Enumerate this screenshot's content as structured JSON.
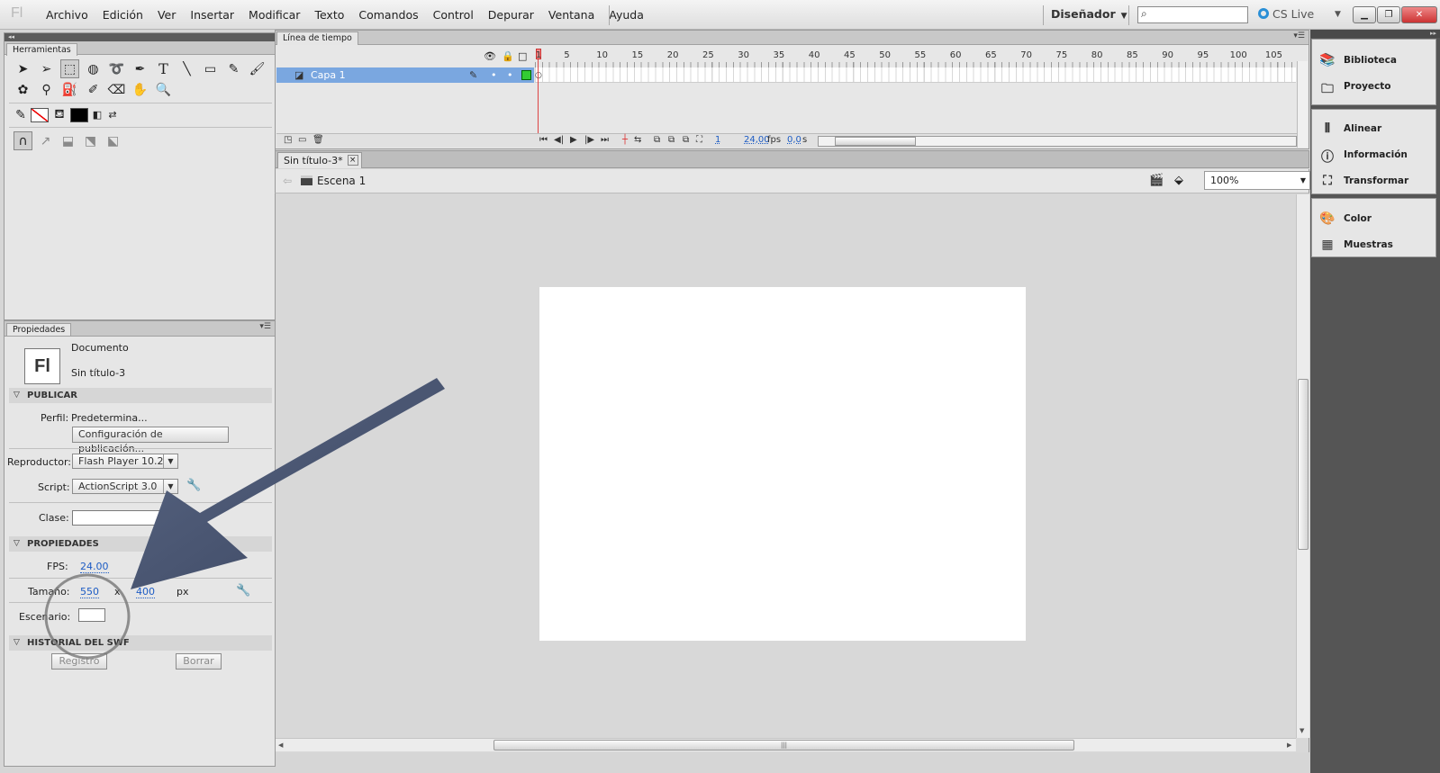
{
  "app": {
    "logo": "Fl",
    "menu": [
      "Archivo",
      "Edición",
      "Ver",
      "Insertar",
      "Modificar",
      "Texto",
      "Comandos",
      "Control",
      "Depurar",
      "Ventana",
      "Ayuda"
    ],
    "workspace": "Diseñador",
    "search_value": "",
    "cs_live": "CS Live"
  },
  "tools_panel": {
    "title": "Herramientas",
    "icons": [
      "selection-tool",
      "subselection-tool",
      "free-transform-tool",
      "3d-rotation-tool",
      "lasso-tool",
      "pen-tool",
      "text-tool",
      "line-tool",
      "rectangle-tool",
      "pencil-tool",
      "brush-tool",
      "deco-tool",
      "bone-tool",
      "paint-bucket-tool",
      "eyedropper-tool",
      "eraser-tool",
      "hand-tool",
      "zoom-tool"
    ],
    "stroke_color": "#ff0000",
    "fill_color": "#000000"
  },
  "properties_panel": {
    "title": "Propiedades",
    "doc_icon": "Fl",
    "doc_type": "Documento",
    "doc_name": "Sin título-3",
    "publish": {
      "section": "PUBLICAR",
      "profile_label": "Perfil:",
      "profile_value": "Predetermina...",
      "config_button": "Configuración de publicación...",
      "player_label": "Reproductor:",
      "player_value": "Flash Player 10.2",
      "script_label": "Script:",
      "script_value": "ActionScript 3.0",
      "class_label": "Clase:",
      "class_value": ""
    },
    "properties": {
      "section": "PROPIEDADES",
      "fps_label": "FPS:",
      "fps_value": "24.00",
      "size_label": "Tamaño:",
      "width": "550",
      "times": "x",
      "height": "400",
      "unit": "px",
      "stage_label": "Escenario:",
      "stage_color": "#ffffff"
    },
    "swf_history": {
      "section": "HISTORIAL DEL SWF",
      "log_button": "Registro",
      "clear_button": "Borrar"
    }
  },
  "timeline": {
    "title": "Línea de tiempo",
    "frame_numbers": [
      "1",
      "5",
      "10",
      "15",
      "20",
      "25",
      "30",
      "35",
      "40",
      "45",
      "50",
      "55",
      "60",
      "65",
      "70",
      "75",
      "80",
      "85",
      "90",
      "95",
      "100",
      "105"
    ],
    "layer_name": "Capa 1",
    "current_frame": "1",
    "fps": "24,00",
    "fps_unit": "fps",
    "time": "0,0",
    "time_unit": "s"
  },
  "document": {
    "tab_title": "Sin título-3*",
    "close_glyph": "×",
    "scene": "Escena 1",
    "zoom": "100%"
  },
  "right_dock": {
    "group1": [
      "Biblioteca",
      "Proyecto"
    ],
    "group2": [
      "Alinear",
      "Información",
      "Transformar"
    ],
    "group3": [
      "Color",
      "Muestras"
    ]
  }
}
